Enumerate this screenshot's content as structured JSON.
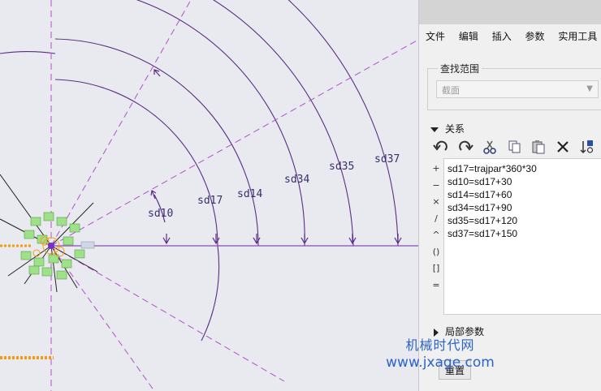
{
  "menu": {
    "items": [
      "文件",
      "编辑",
      "插入",
      "参数",
      "实用工具"
    ]
  },
  "search_scope": {
    "label": "查找范围",
    "value": "截面"
  },
  "relations": {
    "header": "关系",
    "lines": [
      "sd17=trajpar*360*30",
      "sd10=sd17+30",
      "sd14=sd17+60",
      "sd34=sd17+90",
      "sd35=sd17+120",
      "sd37=sd17+150"
    ]
  },
  "side_tools": [
    "+",
    "−",
    "×",
    "/",
    "^",
    "()",
    "[]",
    "="
  ],
  "local_params": {
    "label": "局部参数"
  },
  "reset_button": {
    "label": "重置"
  },
  "dimensions": [
    "sd10",
    "sd17",
    "sd14",
    "sd34",
    "sd35",
    "sd37"
  ],
  "watermark": {
    "line1": "机械时代网",
    "line2": "www.jxage.com"
  },
  "colors": {
    "sketch": "#5a2d86",
    "centerline": "#b24fcf",
    "accent_green": "#9fe08a",
    "orange": "#f39c12"
  }
}
